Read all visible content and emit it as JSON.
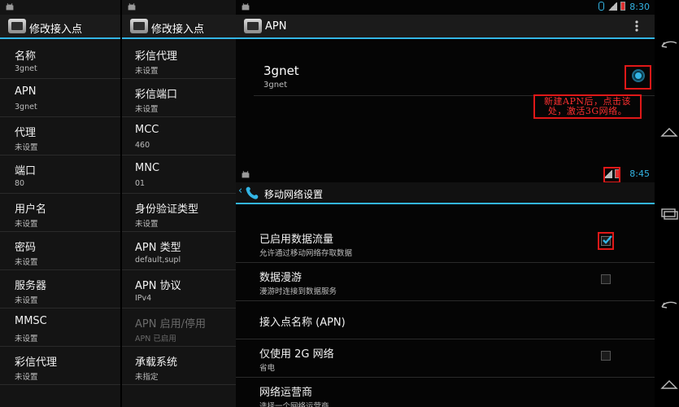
{
  "panel_left": {
    "title": "修改接入点",
    "items": [
      {
        "label": "名称",
        "value": "3gnet"
      },
      {
        "label": "APN",
        "value": "3gnet"
      },
      {
        "label": "代理",
        "value": "未设置"
      },
      {
        "label": "端口",
        "value": "80"
      },
      {
        "label": "用户名",
        "value": "未设置"
      },
      {
        "label": "密码",
        "value": "未设置"
      },
      {
        "label": "服务器",
        "value": "未设置"
      },
      {
        "label": "MMSC",
        "value": "未设置"
      },
      {
        "label": "彩信代理",
        "value": "未设置"
      }
    ]
  },
  "panel_middle": {
    "title": "修改接入点",
    "items": [
      {
        "label": "彩信代理",
        "value": "未设置"
      },
      {
        "label": "彩信端口",
        "value": "未设置"
      },
      {
        "label": "MCC",
        "value": "460"
      },
      {
        "label": "MNC",
        "value": "01"
      },
      {
        "label": "身份验证类型",
        "value": "未设置"
      },
      {
        "label": "APN 类型",
        "value": "default,supl"
      },
      {
        "label": "APN 协议",
        "value": "IPv4"
      },
      {
        "label": "APN 启用/停用",
        "value": "APN 已启用"
      },
      {
        "label": "承载系统",
        "value": "未指定"
      }
    ]
  },
  "panel_right": {
    "time": "8:30",
    "title": "APN",
    "apn": {
      "name": "3gnet",
      "apn": "3gnet"
    },
    "annotation": "新建APN后，点击该处，激活3G网络。",
    "annotation_line1": "新建APN后，点击该",
    "annotation_line2": "处，激活3G网络。",
    "second_time": "8:45",
    "second_title": "移动网络设置",
    "settings": [
      {
        "title": "已启用数据流量",
        "summary": "允许通过移动网络存取数据",
        "checked": true
      },
      {
        "title": "数据漫游",
        "summary": "漫游时连接到数据服务",
        "checked": false
      },
      {
        "title": "接入点名称 (APN)",
        "summary": ""
      },
      {
        "title": "仅使用 2G 网络",
        "summary": "省电",
        "checked": false
      },
      {
        "title": "网络运营商",
        "summary": "选择一个网络运营商"
      }
    ]
  },
  "colors": {
    "accent": "#33b5e5",
    "annotation_red": "#e01818"
  },
  "icons": [
    "android-icon",
    "settings-app-icon",
    "overflow-menu-icon",
    "bluetooth-icon",
    "signal-icon",
    "battery-icon",
    "phone-icon",
    "back-icon",
    "home-icon",
    "recent-apps-icon"
  ]
}
